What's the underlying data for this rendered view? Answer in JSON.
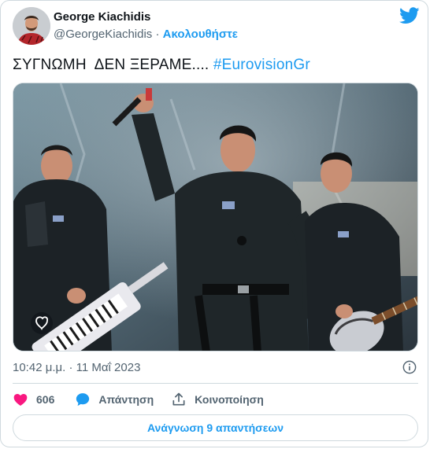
{
  "author": {
    "name": "George Kiachidis",
    "handle": "@GeorgeKiachidis",
    "separator": "·",
    "follow_label": "Ακολουθήστε"
  },
  "tweet": {
    "text": "ΣΥΓΝΩΜΗ  ΔΕΝ ΞΕΡΑΜΕ.... ",
    "hashtag": "#EurovisionGr",
    "timestamp": "10:42 μ.μ. · 11 Μαΐ 2023"
  },
  "media": {
    "description_icon": "photo-of-three-performers-on-stage"
  },
  "actions": {
    "like_count": "606",
    "reply_label": "Απάντηση",
    "share_label": "Κοινοποίηση"
  },
  "read_replies_label": "Ανάγνωση 9 απαντήσεων",
  "colors": {
    "accent": "#1d9bf0",
    "like": "#f91880",
    "muted": "#536471",
    "border": "#cfd9de"
  },
  "icons": {
    "brand": "twitter-bird-icon",
    "info": "info-icon",
    "like": "heart-icon",
    "reply": "speech-bubble-icon",
    "share": "share-upload-icon"
  }
}
